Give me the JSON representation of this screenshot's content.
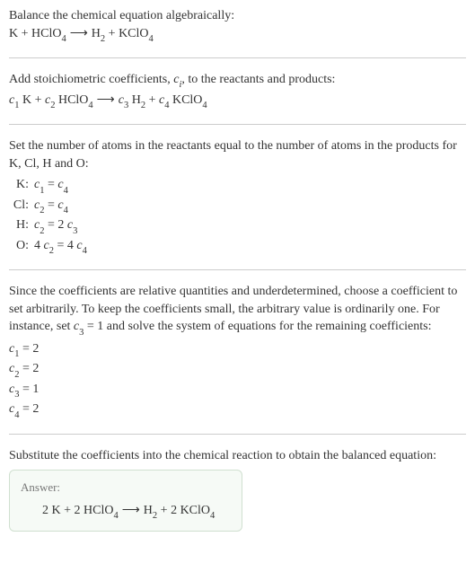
{
  "s1": {
    "line1": "Balance the chemical equation algebraically:"
  },
  "s2": {
    "line1_a": "Add stoichiometric coefficients, ",
    "line1_c": ", to the reactants and products:"
  },
  "s3": {
    "line1": "Set the number of atoms in the reactants equal to the number of atoms in the products for K, Cl, H and O:",
    "rows": {
      "k_key": "K:",
      "cl_key": "Cl:",
      "h_key": "H:",
      "o_key": "O:"
    }
  },
  "s4": {
    "text_a": "Since the coefficients are relative quantities and underdetermined, choose a coefficient to set arbitrarily. To keep the coefficients small, the arbitrary value is ordinarily one. For instance, set ",
    "text_b": " and solve the system of equations for the remaining coefficients:"
  },
  "s5": {
    "line1": "Substitute the coefficients into the chemical reaction to obtain the balanced equation:"
  },
  "answer": {
    "label": "Answer:"
  },
  "chart_data": {
    "type": "table",
    "unbalanced_equation": "K + HClO4 → H2 + KClO4",
    "generic_equation": "c1 K + c2 HClO4 → c3 H2 + c4 KClO4",
    "atom_balance": [
      {
        "element": "K",
        "equation": "c1 = c4"
      },
      {
        "element": "Cl",
        "equation": "c2 = c4"
      },
      {
        "element": "H",
        "equation": "c2 = 2 c3"
      },
      {
        "element": "O",
        "equation": "4 c2 = 4 c4"
      }
    ],
    "chosen": "c3 = 1",
    "solution": {
      "c1": 2,
      "c2": 2,
      "c3": 1,
      "c4": 2
    },
    "balanced_equation": "2 K + 2 HClO4 → H2 + 2 KClO4"
  }
}
